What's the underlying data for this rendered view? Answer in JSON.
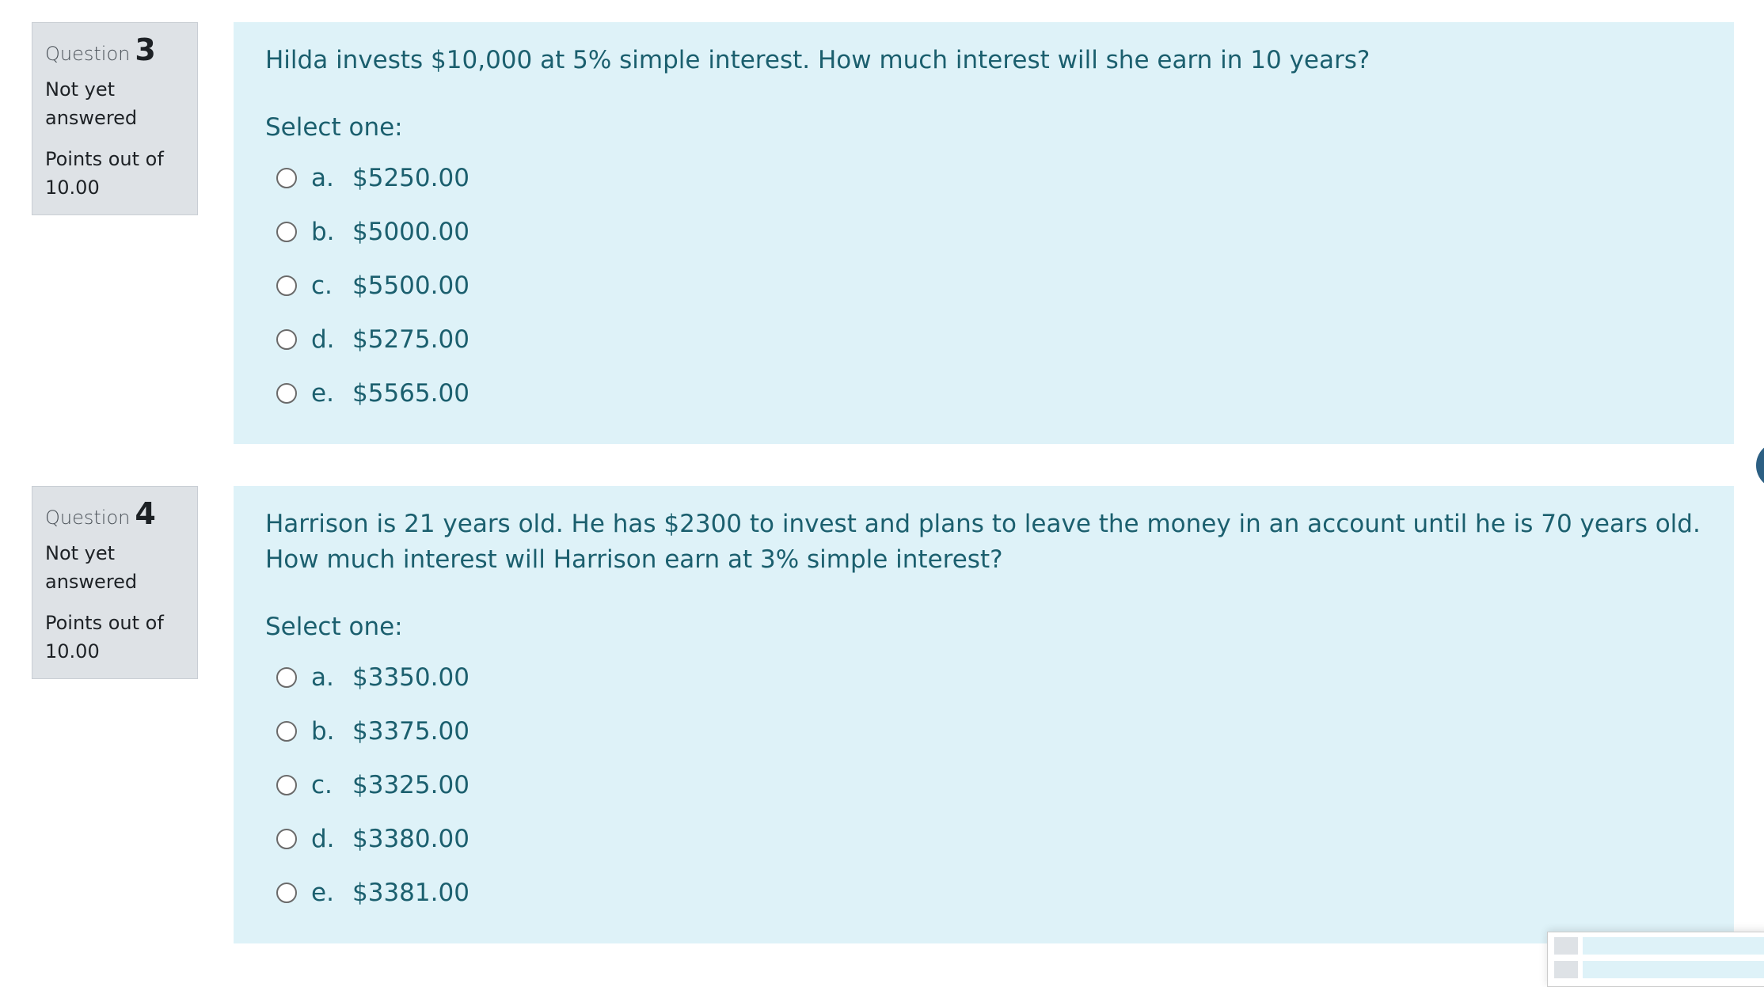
{
  "questions": [
    {
      "label": "Question",
      "number": "3",
      "state": "Not yet answered",
      "grade": "Points out of 10.00",
      "text": "Hilda invests $10,000 at 5% simple interest. How much interest will she earn in 10 years?",
      "prompt": "Select one:",
      "answers": [
        {
          "letter": "a.",
          "value": "$5250.00"
        },
        {
          "letter": "b.",
          "value": "$5000.00"
        },
        {
          "letter": "c.",
          "value": "$5500.00"
        },
        {
          "letter": "d.",
          "value": "$5275.00"
        },
        {
          "letter": "e.",
          "value": "$5565.00"
        }
      ]
    },
    {
      "label": "Question",
      "number": "4",
      "state": "Not yet answered",
      "grade": "Points out of 10.00",
      "text": "Harrison is 21 years old.  He has $2300 to invest and plans to leave the money in an account until he is 70 years old. How much interest will Harrison earn at 3% simple interest?",
      "prompt": "Select one:",
      "answers": [
        {
          "letter": "a.",
          "value": "$3350.00"
        },
        {
          "letter": "b.",
          "value": "$3375.00"
        },
        {
          "letter": "c.",
          "value": "$3325.00"
        },
        {
          "letter": "d.",
          "value": "$3380.00"
        },
        {
          "letter": "e.",
          "value": "$3381.00"
        }
      ]
    }
  ],
  "colors": {
    "info_background": "#dee2e6",
    "content_background": "#def2f8",
    "content_text": "#1b5f6e",
    "side_tab": "#2c5f83"
  }
}
